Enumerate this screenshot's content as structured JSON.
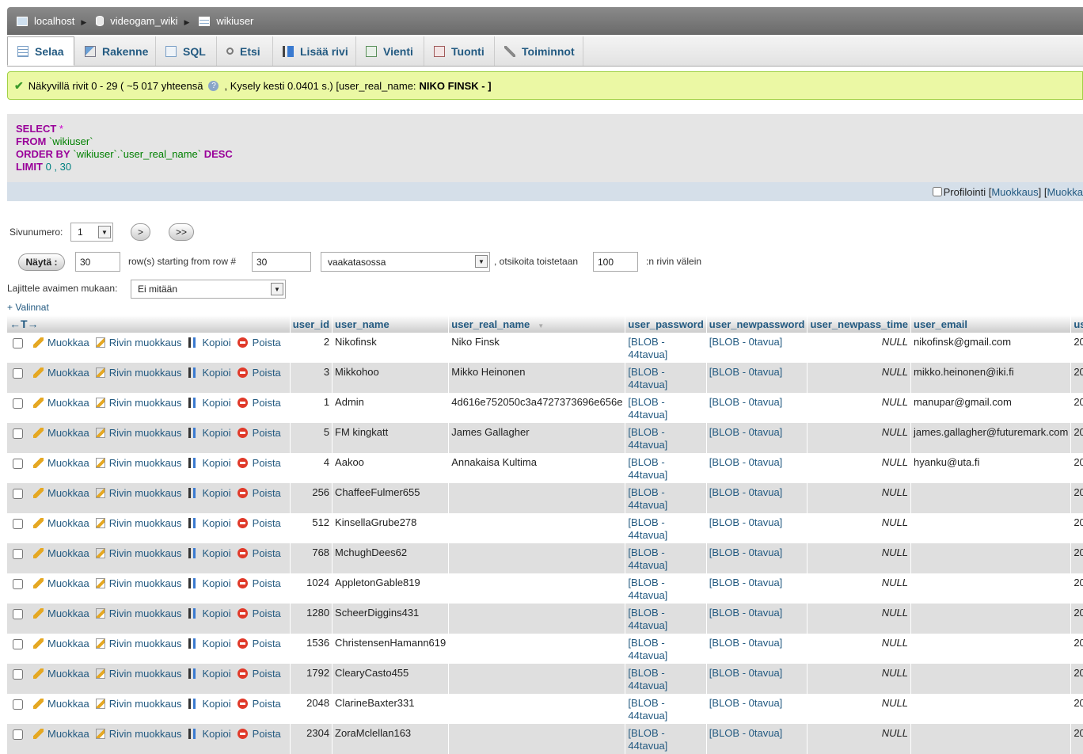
{
  "breadcrumb": {
    "server": "localhost",
    "database": "videogam_wiki",
    "table": "wikiuser"
  },
  "tabs": [
    {
      "label": "Selaa",
      "icon": "browse-icon",
      "active": true
    },
    {
      "label": "Rakenne",
      "icon": "structure-icon"
    },
    {
      "label": "SQL",
      "icon": "sql-icon"
    },
    {
      "label": "Etsi",
      "icon": "search-icon"
    },
    {
      "label": "Lisää rivi",
      "icon": "insert-row-icon"
    },
    {
      "label": "Vienti",
      "icon": "export-icon"
    },
    {
      "label": "Tuonti",
      "icon": "import-icon"
    },
    {
      "label": "Toiminnot",
      "icon": "operations-icon"
    }
  ],
  "notice": {
    "text_before": "Näkyvillä rivit 0 - 29 ( ~5 017 yhteensä",
    "text_after": ", Kysely kesti 0.0401 s.) [user_real_name:",
    "value": "NIKO FINSK - ]",
    "help": "?"
  },
  "sql": {
    "select": "SELECT",
    "star": "*",
    "from": "FROM",
    "table": "`wikiuser`",
    "order_by": "ORDER BY",
    "order_col": "`wikiuser`.`user_real_name`",
    "desc": "DESC",
    "limit": "LIMIT",
    "limit_start": "0",
    "limit_sep": ",",
    "limit_count": "30"
  },
  "sqlbar": {
    "profiling": "Profilointi",
    "edit_link": "Muokkaus",
    "open_bracket": "[",
    "close_bracket": "]",
    "more": "[ ",
    "more_link": "Muokka"
  },
  "nav": {
    "page_label": "Sivunumero:",
    "page_value": "1",
    "next": ">",
    "last": ">>",
    "show_button": "Näytä :",
    "rows_value": "30",
    "rows_label": "row(s) starting from row #",
    "start_value": "30",
    "mode_value": "vaakatasossa",
    "headers_label": ", otsikoita toistetaan",
    "headers_value": "100",
    "every_label": ":n rivin välein",
    "sort_label": "Lajittele avaimen mukaan:",
    "sort_value": "Ei mitään",
    "options_link": "+ Valinnat"
  },
  "table": {
    "col_nav": "←T→",
    "columns": [
      "user_id",
      "user_name",
      "user_real_name",
      "user_password",
      "user_newpassword",
      "user_newpass_time",
      "user_email",
      "use"
    ],
    "actions": {
      "edit": "Muokkaa",
      "inline_edit": "Rivin muokkaus",
      "copy": "Kopioi",
      "delete": "Poista"
    },
    "rows": [
      {
        "id": "2",
        "name": "Nikofinsk",
        "real": "Niko Finsk",
        "pass": "[BLOB - 44tavua]",
        "newpass": "[BLOB - 0tavua]",
        "time": "NULL",
        "email": "nikofinsk@gmail.com",
        "rest": "20"
      },
      {
        "id": "3",
        "name": "Mikkohoo",
        "real": "Mikko Heinonen",
        "pass": "[BLOB - 44tavua]",
        "newpass": "[BLOB - 0tavua]",
        "time": "NULL",
        "email": "mikko.heinonen@iki.fi",
        "rest": "20"
      },
      {
        "id": "1",
        "name": "Admin",
        "real": "4d616e752050c3a4727373696e656e",
        "pass": "[BLOB - 44tavua]",
        "newpass": "[BLOB - 0tavua]",
        "time": "NULL",
        "email": "manupar@gmail.com",
        "rest": "20"
      },
      {
        "id": "5",
        "name": "FM kingkatt",
        "real": "James Gallagher",
        "pass": "[BLOB - 44tavua]",
        "newpass": "[BLOB - 0tavua]",
        "time": "NULL",
        "email": "james.gallagher@futuremark.com",
        "rest": "20"
      },
      {
        "id": "4",
        "name": "Aakoo",
        "real": "Annakaisa Kultima",
        "pass": "[BLOB - 44tavua]",
        "newpass": "[BLOB - 0tavua]",
        "time": "NULL",
        "email": "hyanku@uta.fi",
        "rest": "20"
      },
      {
        "id": "256",
        "name": "ChaffeeFulmer655",
        "real": "",
        "pass": "[BLOB - 44tavua]",
        "newpass": "[BLOB - 0tavua]",
        "time": "NULL",
        "email": "",
        "rest": "20"
      },
      {
        "id": "512",
        "name": "KinsellaGrube278",
        "real": "",
        "pass": "[BLOB - 44tavua]",
        "newpass": "[BLOB - 0tavua]",
        "time": "NULL",
        "email": "",
        "rest": "20"
      },
      {
        "id": "768",
        "name": "MchughDees62",
        "real": "",
        "pass": "[BLOB - 44tavua]",
        "newpass": "[BLOB - 0tavua]",
        "time": "NULL",
        "email": "",
        "rest": "20"
      },
      {
        "id": "1024",
        "name": "AppletonGable819",
        "real": "",
        "pass": "[BLOB - 44tavua]",
        "newpass": "[BLOB - 0tavua]",
        "time": "NULL",
        "email": "",
        "rest": "20"
      },
      {
        "id": "1280",
        "name": "ScheerDiggins431",
        "real": "",
        "pass": "[BLOB - 44tavua]",
        "newpass": "[BLOB - 0tavua]",
        "time": "NULL",
        "email": "",
        "rest": "20"
      },
      {
        "id": "1536",
        "name": "ChristensenHamann619",
        "real": "",
        "pass": "[BLOB - 44tavua]",
        "newpass": "[BLOB - 0tavua]",
        "time": "NULL",
        "email": "",
        "rest": "20"
      },
      {
        "id": "1792",
        "name": "ClearyCasto455",
        "real": "",
        "pass": "[BLOB - 44tavua]",
        "newpass": "[BLOB - 0tavua]",
        "time": "NULL",
        "email": "",
        "rest": "20"
      },
      {
        "id": "2048",
        "name": "ClarineBaxter331",
        "real": "",
        "pass": "[BLOB - 44tavua]",
        "newpass": "[BLOB - 0tavua]",
        "time": "NULL",
        "email": "",
        "rest": "20"
      },
      {
        "id": "2304",
        "name": "ZoraMclellan163",
        "real": "",
        "pass": "[BLOB - 44tavua]",
        "newpass": "[BLOB - 0tavua]",
        "time": "NULL",
        "email": "",
        "rest": "20"
      }
    ]
  }
}
